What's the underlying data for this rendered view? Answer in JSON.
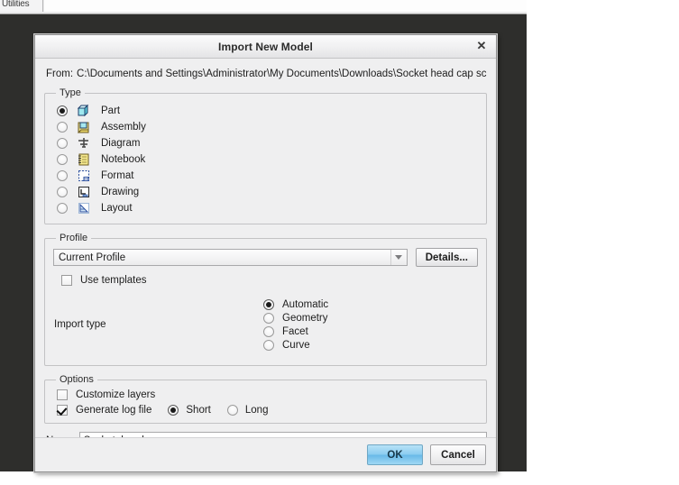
{
  "background_app": {
    "tab_label": "Utilities"
  },
  "dialog": {
    "title": "Import New Model",
    "close_icon": "close-icon",
    "from": {
      "label": "From:",
      "path": "C:\\Documents and Settings\\Administrator\\My Documents\\Downloads\\Socket head cap screw.stp"
    },
    "type_group": {
      "legend": "Type",
      "items": [
        {
          "label": "Part",
          "icon": "cube-icon",
          "selected": true
        },
        {
          "label": "Assembly",
          "icon": "assembly-icon",
          "selected": false
        },
        {
          "label": "Diagram",
          "icon": "diagram-icon",
          "selected": false
        },
        {
          "label": "Notebook",
          "icon": "notebook-icon",
          "selected": false
        },
        {
          "label": "Format",
          "icon": "format-icon",
          "selected": false
        },
        {
          "label": "Drawing",
          "icon": "drawing-icon",
          "selected": false
        },
        {
          "label": "Layout",
          "icon": "layout-icon",
          "selected": false
        }
      ]
    },
    "profile_group": {
      "legend": "Profile",
      "combo_value": "Current Profile",
      "combo_caret_icon": "chevron-down-icon",
      "details_button": "Details...",
      "use_templates": {
        "label": "Use templates",
        "checked": false
      },
      "import_type": {
        "label": "Import type",
        "options": [
          {
            "label": "Automatic",
            "selected": true
          },
          {
            "label": "Geometry",
            "selected": false
          },
          {
            "label": "Facet",
            "selected": false
          },
          {
            "label": "Curve",
            "selected": false
          }
        ]
      }
    },
    "options_group": {
      "legend": "Options",
      "customize_layers": {
        "label": "Customize layers",
        "checked": false
      },
      "generate_log_file": {
        "label": "Generate log file",
        "checked": true
      },
      "log_detail": [
        {
          "label": "Short",
          "selected": true
        },
        {
          "label": "Long",
          "selected": false
        }
      ]
    },
    "name_row": {
      "label": "Name",
      "value": "Socket_head_cap_screw"
    },
    "footer": {
      "ok_label": "OK",
      "cancel_label": "Cancel"
    },
    "colors": {
      "accent": "#8ccdf0",
      "dialog_bg": "#efeff0",
      "backdrop": "#2e2e2c"
    }
  }
}
